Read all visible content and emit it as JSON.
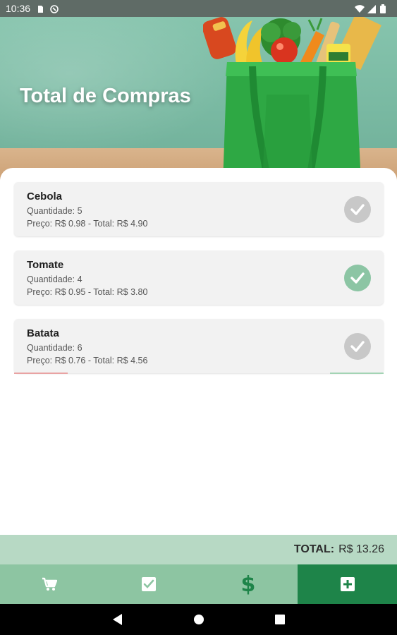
{
  "status_bar": {
    "time": "10:36",
    "icons_left": [
      "sd-card-icon",
      "sync-icon"
    ],
    "icons_right": [
      "wifi-icon",
      "signal-icon",
      "battery-icon"
    ]
  },
  "header": {
    "title": "Total de Compras",
    "image": "grocery-bag-illustration"
  },
  "items": [
    {
      "name": "Cebola",
      "quantity_label": "Quantidade: 5",
      "price_label": "Preço: R$ 0.98 - Total: R$ 4.90",
      "checked": false
    },
    {
      "name": "Tomate",
      "quantity_label": "Quantidade: 4",
      "price_label": "Preço: R$ 0.95 - Total: R$ 3.80",
      "checked": true
    },
    {
      "name": "Batata",
      "quantity_label": "Quantidade: 6",
      "price_label": "Preço: R$ 0.76 - Total: R$ 4.56",
      "checked": false
    }
  ],
  "total": {
    "label": "TOTAL:",
    "value": "R$ 13.26"
  },
  "bottom_nav": {
    "items": [
      {
        "icon": "cart-icon",
        "active": false
      },
      {
        "icon": "checklist-icon",
        "active": false
      },
      {
        "icon": "dollar-icon",
        "symbol": "$",
        "active": false
      },
      {
        "icon": "add-icon",
        "active": true
      }
    ]
  },
  "colors": {
    "primary_dark": "#1e8449",
    "primary_light": "#8dc5a2",
    "total_bar": "#b7d9c4",
    "check_on": "#8cc5a4",
    "check_off": "#c8c8c8"
  }
}
